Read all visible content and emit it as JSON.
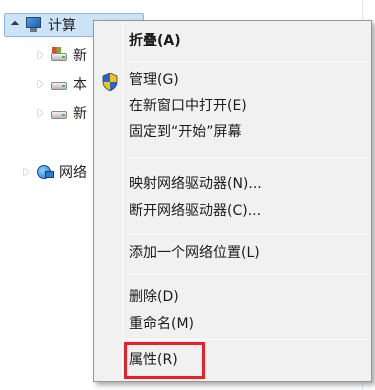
{
  "nav": {
    "computer": "计算",
    "items": [
      {
        "label": "新",
        "icon": "system-drive-icon"
      },
      {
        "label": "本",
        "icon": "drive-icon"
      },
      {
        "label": "新",
        "icon": "drive-icon"
      }
    ],
    "network": "网络"
  },
  "menu": {
    "collapse": "折叠(A)",
    "manage": "管理(G)",
    "open_new_window": "在新窗口中打开(E)",
    "pin_start": "固定到“开始”屏幕",
    "map_drive": "映射网络驱动器(N)...",
    "disconnect_drive": "断开网络驱动器(C)...",
    "add_network_location": "添加一个网络位置(L)",
    "delete": "删除(D)",
    "rename": "重命名(M)",
    "properties": "属性(R)"
  },
  "colors": {
    "highlight": "#e8202a",
    "menu_bg": "#f1f1f1"
  }
}
